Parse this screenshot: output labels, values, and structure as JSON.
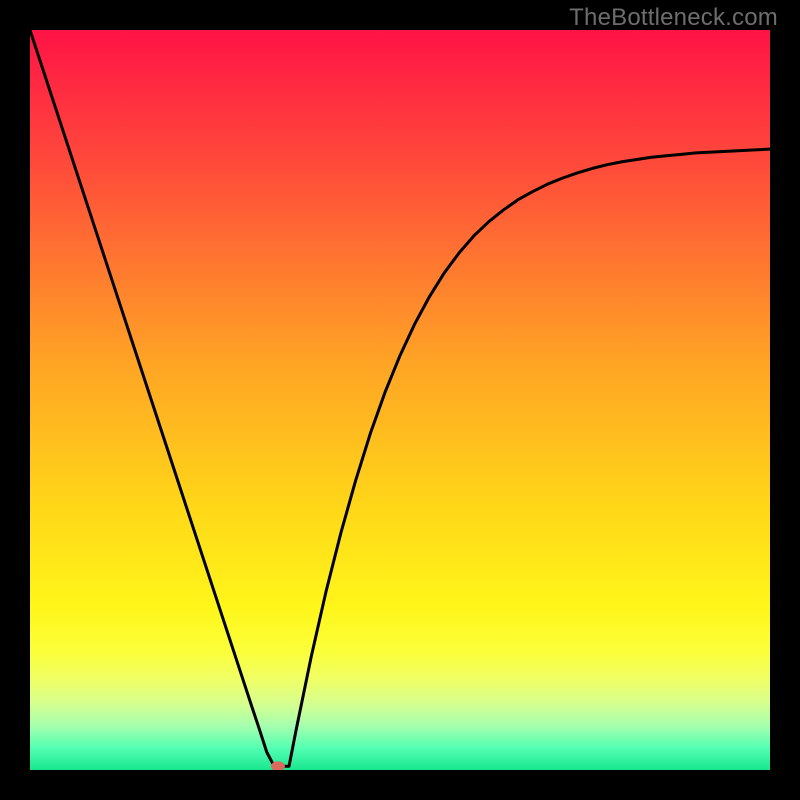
{
  "watermark": "TheBottleneck.com",
  "chart_data": {
    "type": "line",
    "title": "",
    "xlabel": "",
    "ylabel": "",
    "xlim": [
      0,
      100
    ],
    "ylim": [
      0,
      100
    ],
    "x": [
      0,
      2,
      4,
      6,
      8,
      10,
      12,
      14,
      16,
      18,
      20,
      22,
      24,
      26,
      28,
      30,
      31,
      32,
      33,
      34,
      35,
      36,
      38,
      40,
      42,
      44,
      46,
      48,
      50,
      52,
      54,
      56,
      58,
      60,
      62,
      64,
      66,
      68,
      70,
      72,
      74,
      76,
      78,
      80,
      82,
      84,
      86,
      88,
      90,
      92,
      94,
      96,
      98,
      100
    ],
    "values": [
      100,
      93.9,
      87.8,
      81.7,
      75.6,
      69.5,
      63.4,
      57.3,
      51.2,
      45.1,
      39.0,
      32.9,
      26.8,
      20.7,
      14.6,
      8.5,
      5.5,
      2.4,
      0.5,
      0.5,
      0.5,
      5.6,
      15.3,
      24.1,
      32.0,
      39.1,
      45.5,
      51.1,
      56.0,
      60.3,
      64.0,
      67.2,
      69.9,
      72.2,
      74.1,
      75.7,
      77.1,
      78.2,
      79.2,
      80.0,
      80.7,
      81.3,
      81.8,
      82.2,
      82.5,
      82.8,
      83.0,
      83.2,
      83.4,
      83.5,
      83.6,
      83.7,
      83.8,
      83.9
    ],
    "marker": {
      "x": 33.5,
      "y": 0.5,
      "color": "#d96a5d",
      "rx": 7,
      "ry": 5
    },
    "gradient_stops": [
      {
        "offset": 0,
        "color": "#ff1346"
      },
      {
        "offset": 18,
        "color": "#ff4a3b"
      },
      {
        "offset": 45,
        "color": "#ffa425"
      },
      {
        "offset": 65,
        "color": "#ffd818"
      },
      {
        "offset": 78,
        "color": "#fff61a"
      },
      {
        "offset": 84,
        "color": "#fbff3a"
      },
      {
        "offset": 88,
        "color": "#efff69"
      },
      {
        "offset": 91,
        "color": "#d6ff8f"
      },
      {
        "offset": 94,
        "color": "#a6ffad"
      },
      {
        "offset": 97,
        "color": "#55ffb3"
      },
      {
        "offset": 100,
        "color": "#18e68f"
      }
    ]
  }
}
